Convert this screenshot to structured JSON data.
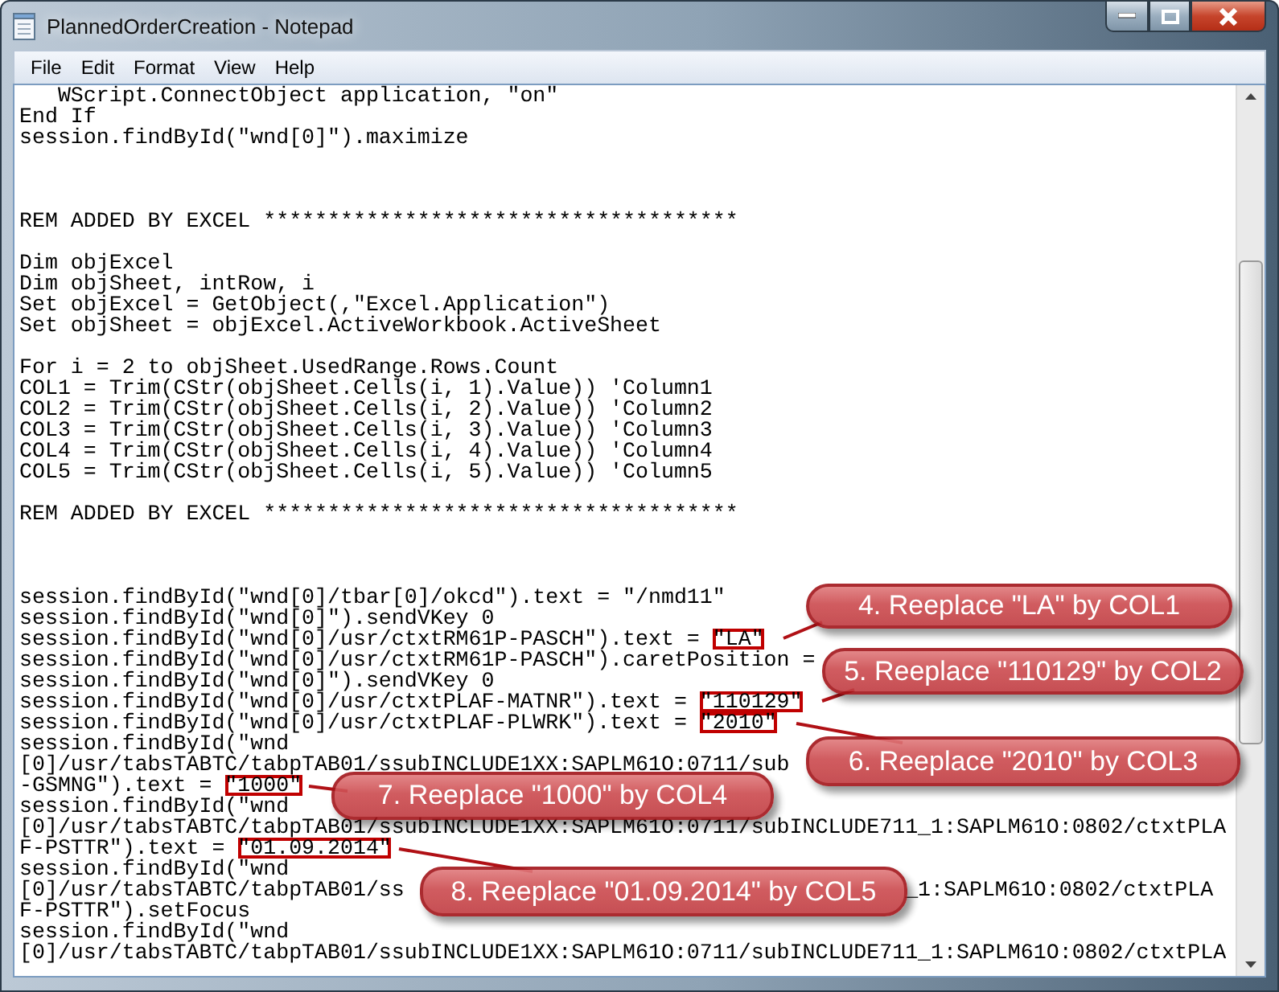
{
  "window": {
    "title": "PlannedOrderCreation - Notepad"
  },
  "menu": [
    {
      "label": "File"
    },
    {
      "label": "Edit"
    },
    {
      "label": "Format"
    },
    {
      "label": "View"
    },
    {
      "label": "Help"
    }
  ],
  "lines": [
    {
      "kind": "code",
      "text": "   WScript.ConnectObject application, \"on\""
    },
    {
      "kind": "code",
      "text": "End If"
    },
    {
      "kind": "code",
      "text": "session.findById(\"wnd[0]\").maximize"
    },
    {
      "kind": "blank"
    },
    {
      "kind": "blank"
    },
    {
      "kind": "blank"
    },
    {
      "kind": "code",
      "text": "REM ADDED BY EXCEL *************************************"
    },
    {
      "kind": "blank"
    },
    {
      "kind": "code",
      "text": "Dim objExcel"
    },
    {
      "kind": "code",
      "text": "Dim objSheet, intRow, i"
    },
    {
      "kind": "code",
      "text": "Set objExcel = GetObject(,\"Excel.Application\")"
    },
    {
      "kind": "code",
      "text": "Set objSheet = objExcel.ActiveWorkbook.ActiveSheet"
    },
    {
      "kind": "blank"
    },
    {
      "kind": "code",
      "text": "For i = 2 to objSheet.UsedRange.Rows.Count"
    },
    {
      "kind": "code",
      "text": "COL1 = Trim(CStr(objSheet.Cells(i, 1).Value)) 'Column1"
    },
    {
      "kind": "code",
      "text": "COL2 = Trim(CStr(objSheet.Cells(i, 2).Value)) 'Column2"
    },
    {
      "kind": "code",
      "text": "COL3 = Trim(CStr(objSheet.Cells(i, 3).Value)) 'Column3"
    },
    {
      "kind": "code",
      "text": "COL4 = Trim(CStr(objSheet.Cells(i, 4).Value)) 'Column4"
    },
    {
      "kind": "code",
      "text": "COL5 = Trim(CStr(objSheet.Cells(i, 5).Value)) 'Column5"
    },
    {
      "kind": "blank"
    },
    {
      "kind": "code",
      "text": "REM ADDED BY EXCEL *************************************"
    },
    {
      "kind": "blank"
    },
    {
      "kind": "blank"
    },
    {
      "kind": "blank"
    },
    {
      "kind": "code",
      "text": "session.findById(\"wnd[0]/tbar[0]/okcd\").text = \"/nmd11\""
    },
    {
      "kind": "code",
      "text": "session.findById(\"wnd[0]\").sendVKey 0"
    },
    {
      "kind": "code",
      "text": "session.findById(\"wnd[0]/usr/ctxtRM61P-PASCH\").text = ",
      "marked": "\"LA\""
    },
    {
      "kind": "code",
      "text": "session.findById(\"wnd[0]/usr/ctxtRM61P-PASCH\").caretPosition ="
    },
    {
      "kind": "code",
      "text": "session.findById(\"wnd[0]\").sendVKey 0"
    },
    {
      "kind": "code",
      "text": "session.findById(\"wnd[0]/usr/ctxtPLAF-MATNR\").text = ",
      "marked": "\"110129\""
    },
    {
      "kind": "code",
      "text": "session.findById(\"wnd[0]/usr/ctxtPLAF-PLWRK\").text = ",
      "marked": "\"2010\""
    },
    {
      "kind": "code",
      "text": "session.findById(\"wnd"
    },
    {
      "kind": "code",
      "text": "[0]/usr/tabsTABTC/tabpTAB01/ssubINCLUDE1XX:SAPLM61O:0711/sub"
    },
    {
      "kind": "code",
      "text": "-GSMNG\").text = ",
      "marked": "\"1000\""
    },
    {
      "kind": "code",
      "text": "session.findById(\"wnd"
    },
    {
      "kind": "code",
      "text": "[0]/usr/tabsTABTC/tabpTAB01/ssubINCLUDE1XX:SAPLM61O:0711/subINCLUDE711_1:SAPLM61O:0802/ctxtPLA"
    },
    {
      "kind": "code",
      "text": "F-PSTTR\").text = ",
      "marked": "\"01.09.2014\""
    },
    {
      "kind": "code",
      "text": "session.findById(\"wnd"
    },
    {
      "kind": "code",
      "text": "[0]/usr/tabsTABTC/tabpTAB01/ss",
      "after": "_1:SAPLM61O:0802/ctxtPLA"
    },
    {
      "kind": "code",
      "text": "F-PSTTR\").setFocus"
    },
    {
      "kind": "code",
      "text": "session.findById(\"wnd"
    },
    {
      "kind": "code",
      "text": "[0]/usr/tabsTABTC/tabpTAB01/ssubINCLUDE1XX:SAPLM61O:0711/subINCLUDE711_1:SAPLM61O:0802/ctxtPLA"
    }
  ],
  "callouts": [
    {
      "label": "4. Reeplace \"LA\" by COL1"
    },
    {
      "label": "5. Reeplace \"110129\" by COL2"
    },
    {
      "label": "6. Reeplace \"2010\" by COL3"
    },
    {
      "label": "7. Reeplace \"1000\" by COL4"
    },
    {
      "label": "8. Reeplace \"01.09.2014\" by COL5"
    }
  ]
}
